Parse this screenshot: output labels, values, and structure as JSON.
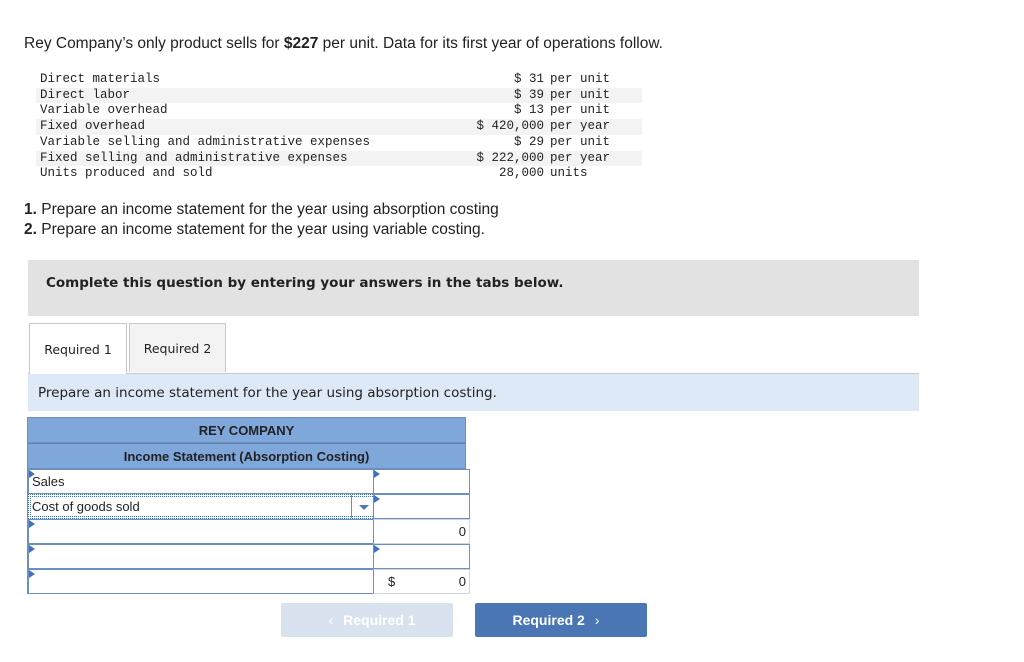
{
  "intro": {
    "before": "Rey Company’s only product sells for ",
    "price": "$227",
    "after": " per unit. Data for its first year of operations follow."
  },
  "data_table": [
    {
      "label": "Direct materials",
      "amount": "$ 31",
      "unit": "per unit"
    },
    {
      "label": "Direct labor",
      "amount": "$ 39",
      "unit": "per unit"
    },
    {
      "label": "Variable overhead",
      "amount": "$ 13",
      "unit": "per unit"
    },
    {
      "label": "Fixed overhead",
      "amount": "$ 420,000",
      "unit": "per year"
    },
    {
      "label": "Variable selling and administrative expenses",
      "amount": "$ 29",
      "unit": "per unit"
    },
    {
      "label": "Fixed selling and administrative expenses",
      "amount": "$ 222,000",
      "unit": "per year"
    },
    {
      "label": "Units produced and sold",
      "amount": "28,000",
      "unit": "units"
    }
  ],
  "requirements": [
    {
      "num": "1.",
      "text": " Prepare an income statement for the year using absorption costing"
    },
    {
      "num": "2.",
      "text": " Prepare an income statement for the year using variable costing."
    }
  ],
  "banner": "Complete this question by entering your answers in the tabs below.",
  "tabs": [
    {
      "label": "Required 1",
      "active": true
    },
    {
      "label": "Required 2",
      "active": false
    }
  ],
  "instruction": "Prepare an income statement for the year using absorption costing.",
  "statement": {
    "company": "REY COMPANY",
    "title": "Income Statement (Absorption Costing)",
    "rows": [
      {
        "label": "Sales",
        "value": ""
      },
      {
        "label": "Cost of goods sold",
        "value": ""
      },
      {
        "label": "",
        "value": "0"
      },
      {
        "label": "",
        "value": ""
      },
      {
        "label": "",
        "currency": "$",
        "value": "0"
      }
    ]
  },
  "nav": {
    "prev_label": "Required 1",
    "next_label": "Required 2",
    "prev_icon": "‹",
    "next_icon": "›"
  }
}
